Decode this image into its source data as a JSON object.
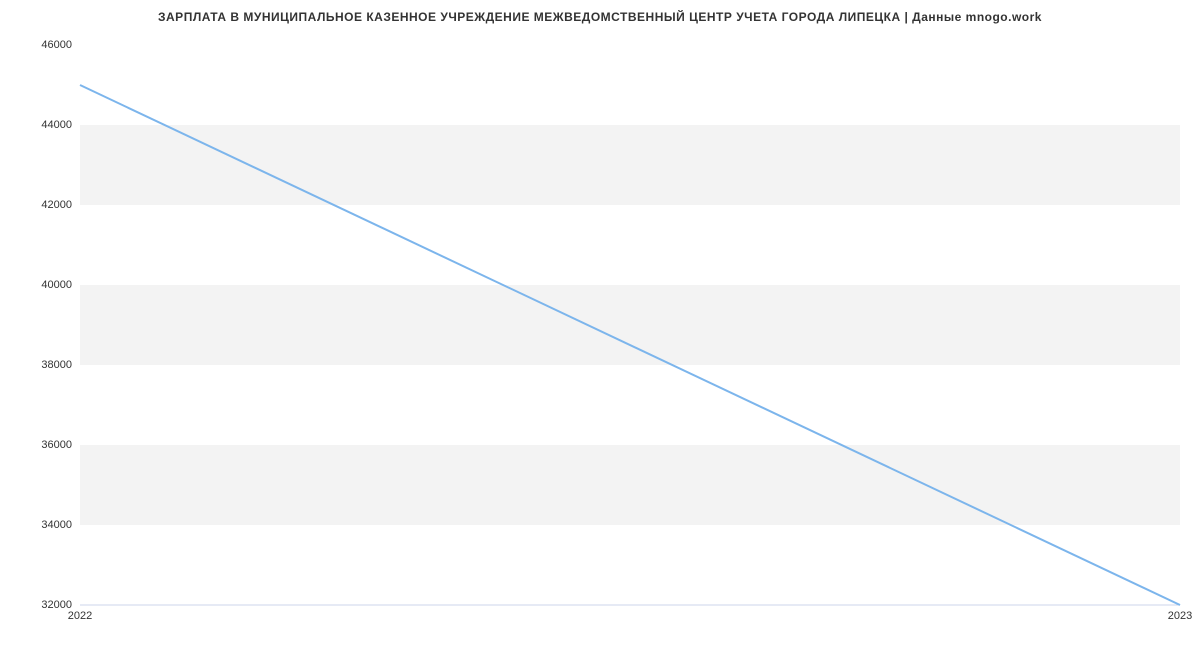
{
  "chart_data": {
    "type": "line",
    "title": "ЗАРПЛАТА В МУНИЦИПАЛЬНОЕ КАЗЕННОЕ УЧРЕЖДЕНИЕ МЕЖВЕДОМСТВЕННЫЙ ЦЕНТР УЧЕТА ГОРОДА ЛИПЕЦКА | Данные mnogo.work",
    "x": [
      2022,
      2023
    ],
    "values": [
      45000,
      32000
    ],
    "xlabel": "",
    "ylabel": "",
    "ylim": [
      32000,
      46000
    ],
    "y_ticks": [
      32000,
      34000,
      36000,
      38000,
      40000,
      42000,
      44000,
      46000
    ],
    "x_ticks": [
      2022,
      2023
    ],
    "line_color": "#7cb5ec",
    "band_color": "#f3f3f3"
  }
}
